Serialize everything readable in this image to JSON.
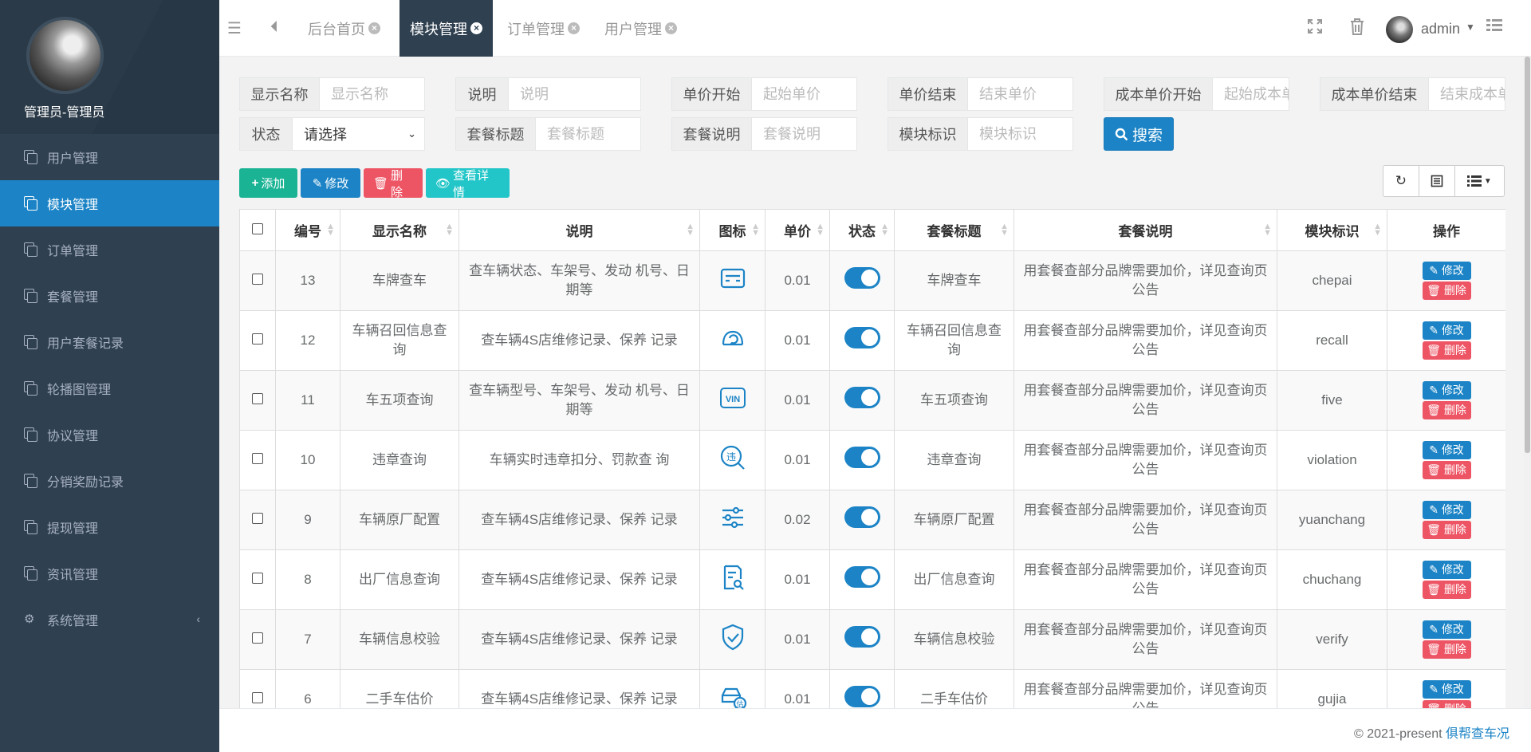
{
  "sidebar": {
    "admin_name": "管理员-管理员",
    "items": [
      {
        "label": "用户管理",
        "icon": "copy-icon"
      },
      {
        "label": "模块管理",
        "icon": "copy-icon"
      },
      {
        "label": "订单管理",
        "icon": "copy-icon"
      },
      {
        "label": "套餐管理",
        "icon": "copy-icon"
      },
      {
        "label": "用户套餐记录",
        "icon": "copy-icon"
      },
      {
        "label": "轮播图管理",
        "icon": "copy-icon"
      },
      {
        "label": "协议管理",
        "icon": "copy-icon"
      },
      {
        "label": "分销奖励记录",
        "icon": "copy-icon"
      },
      {
        "label": "提现管理",
        "icon": "copy-icon"
      },
      {
        "label": "资讯管理",
        "icon": "copy-icon"
      },
      {
        "label": "系统管理",
        "icon": "gears-icon"
      }
    ],
    "active_item": "模块管理",
    "active_color": "#1c84c6"
  },
  "topbar": {
    "tabs": [
      {
        "label": "后台首页"
      },
      {
        "label": "模块管理"
      },
      {
        "label": "订单管理"
      },
      {
        "label": "用户管理"
      }
    ],
    "user": "admin"
  },
  "search": {
    "fields": [
      {
        "label": "显示名称",
        "placeholder": "显示名称"
      },
      {
        "label": "说明",
        "placeholder": "说明"
      },
      {
        "label": "单价开始",
        "placeholder": "起始单价"
      },
      {
        "label": "单价结束",
        "placeholder": "结束单价"
      },
      {
        "label": "成本单价开始",
        "placeholder": "起始成本单价"
      },
      {
        "label": "成本单价结束",
        "placeholder": "结束成本单价"
      },
      {
        "label": "状态",
        "value": "请选择"
      },
      {
        "label": "套餐标题",
        "placeholder": "套餐标题"
      },
      {
        "label": "套餐说明",
        "placeholder": "套餐说明"
      },
      {
        "label": "模块标识",
        "placeholder": "模块标识"
      }
    ],
    "button": "搜索"
  },
  "toolbar": {
    "add": "添加",
    "edit": "修改",
    "delete": "删除",
    "view": "查看详情"
  },
  "table": {
    "headers": [
      "编号",
      "显示名称",
      "说明",
      "图标",
      "单价",
      "状态",
      "套餐标题",
      "套餐说明",
      "模块标识",
      "操作"
    ],
    "edit_label": "修改",
    "delete_label": "删除",
    "rows": [
      {
        "id": "13",
        "name": "车牌查车",
        "desc": "查车辆状态、车架号、发动 机号、日期等",
        "icon": "plate-card-icon",
        "price": "0.01",
        "status_on": true,
        "pkg_title": "车牌查车",
        "pkg_desc": "用套餐查部分品牌需要加价，详见查询页公告",
        "key": "chepai"
      },
      {
        "id": "12",
        "name": "车辆召回信息查询",
        "desc": "查车辆4S店维修记录、保养 记录",
        "icon": "recall-icon",
        "price": "0.01",
        "status_on": true,
        "pkg_title": "车辆召回信息查询",
        "pkg_desc": "用套餐查部分品牌需要加价，详见查询页公告",
        "key": "recall"
      },
      {
        "id": "11",
        "name": "车五项查询",
        "desc": "查车辆型号、车架号、发动 机号、日期等",
        "icon": "vin-icon",
        "price": "0.01",
        "status_on": true,
        "pkg_title": "车五项查询",
        "pkg_desc": "用套餐查部分品牌需要加价，详见查询页公告",
        "key": "five"
      },
      {
        "id": "10",
        "name": "违章查询",
        "desc": "车辆实时违章扣分、罚款查 询",
        "icon": "violation-search-icon",
        "price": "0.01",
        "status_on": true,
        "pkg_title": "违章查询",
        "pkg_desc": "用套餐查部分品牌需要加价，详见查询页公告",
        "key": "violation"
      },
      {
        "id": "9",
        "name": "车辆原厂配置",
        "desc": "查车辆4S店维修记录、保养 记录",
        "icon": "sliders-icon",
        "price": "0.02",
        "status_on": true,
        "pkg_title": "车辆原厂配置",
        "pkg_desc": "用套餐查部分品牌需要加价，详见查询页公告",
        "key": "yuanchang"
      },
      {
        "id": "8",
        "name": "出厂信息查询",
        "desc": "查车辆4S店维修记录、保养 记录",
        "icon": "document-search-icon",
        "price": "0.01",
        "status_on": true,
        "pkg_title": "出厂信息查询",
        "pkg_desc": "用套餐查部分品牌需要加价，详见查询页公告",
        "key": "chuchang"
      },
      {
        "id": "7",
        "name": "车辆信息校验",
        "desc": "查车辆4S店维修记录、保养 记录",
        "icon": "shield-check-icon",
        "price": "0.01",
        "status_on": true,
        "pkg_title": "车辆信息校验",
        "pkg_desc": "用套餐查部分品牌需要加价，详见查询页公告",
        "key": "verify"
      },
      {
        "id": "6",
        "name": "二手车估价",
        "desc": "查车辆4S店维修记录、保养 记录",
        "icon": "car-valuation-icon",
        "price": "0.01",
        "status_on": true,
        "pkg_title": "二手车估价",
        "pkg_desc": "用套餐查部分品牌需要加价，详见查询页公告",
        "key": "gujia"
      }
    ]
  },
  "footer": {
    "text": "© 2021-present ",
    "link": "俱帮查车况"
  }
}
